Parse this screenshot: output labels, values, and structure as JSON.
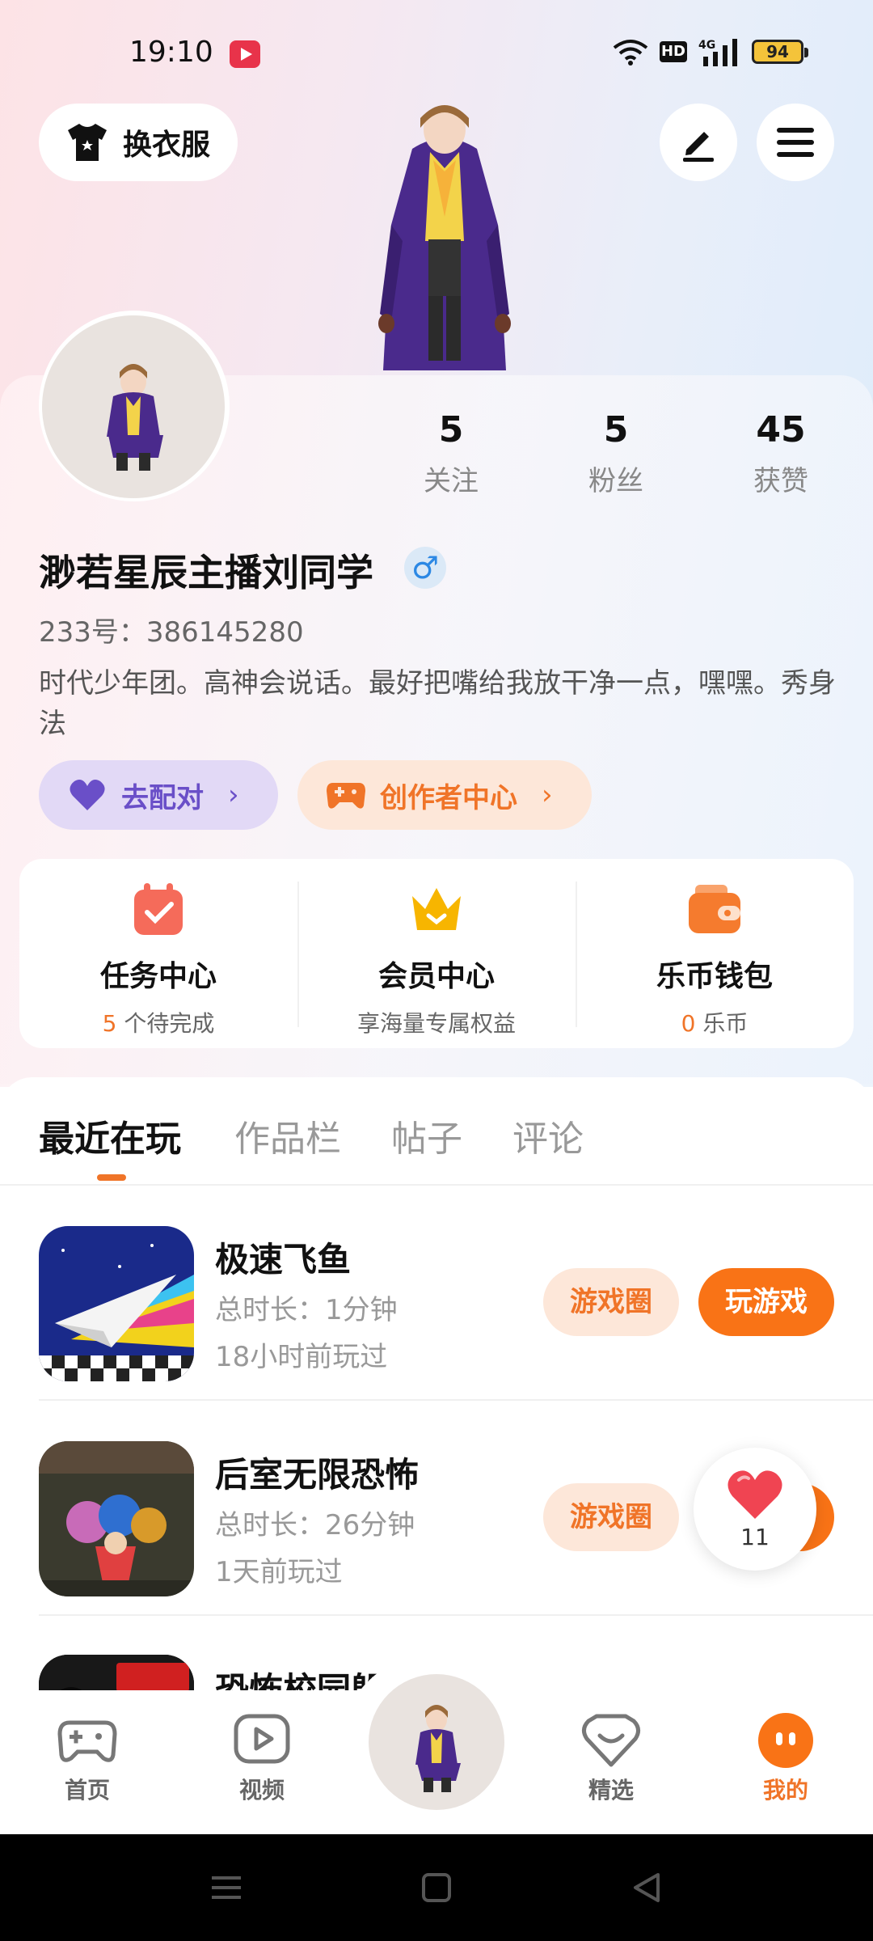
{
  "status_bar": {
    "time": "19:10",
    "battery": "94",
    "hd": "HD"
  },
  "colors": {
    "accent": "#f07428",
    "play": "#f97316",
    "match": "#6a4fc8"
  },
  "header": {
    "outfit_label": "换衣服"
  },
  "profile": {
    "stats": [
      {
        "value": "5",
        "label": "关注"
      },
      {
        "value": "5",
        "label": "粉丝"
      },
      {
        "value": "45",
        "label": "获赞"
      }
    ],
    "nickname": "渺若星辰主播刘同学",
    "gender_icon": "♂",
    "uid": "233号：386145280",
    "bio": "时代少年团。高神会说话。最好把嘴给我放干净一点，嘿嘿。秀身法",
    "match_label": "去配对",
    "creator_label": "创作者中心"
  },
  "quick_entries": [
    {
      "title": "任务中心",
      "count": "5",
      "suffix": " 个待完成"
    },
    {
      "title": "会员中心",
      "subtitle": "享海量专属权益"
    },
    {
      "title": "乐币钱包",
      "count": "0",
      "suffix": " 乐币"
    }
  ],
  "tabs": [
    "最近在玩",
    "作品栏",
    "帖子",
    "评论"
  ],
  "games": [
    {
      "title": "极速飞鱼",
      "duration": "总时长：1分钟",
      "last_played": "18小时前玩过",
      "circle_label": "游戏圈",
      "play_label": "玩游戏"
    },
    {
      "title": "后室无限恐怖",
      "duration": "总时长：26分钟",
      "last_played": "1天前玩过",
      "circle_label": "游戏圈"
    },
    {
      "title": "恐怖校园躲"
    }
  ],
  "like_bubble": {
    "count": "11"
  },
  "nav": [
    {
      "label": "首页"
    },
    {
      "label": "视频"
    },
    {
      "label": "精选"
    },
    {
      "label": "我的"
    }
  ]
}
